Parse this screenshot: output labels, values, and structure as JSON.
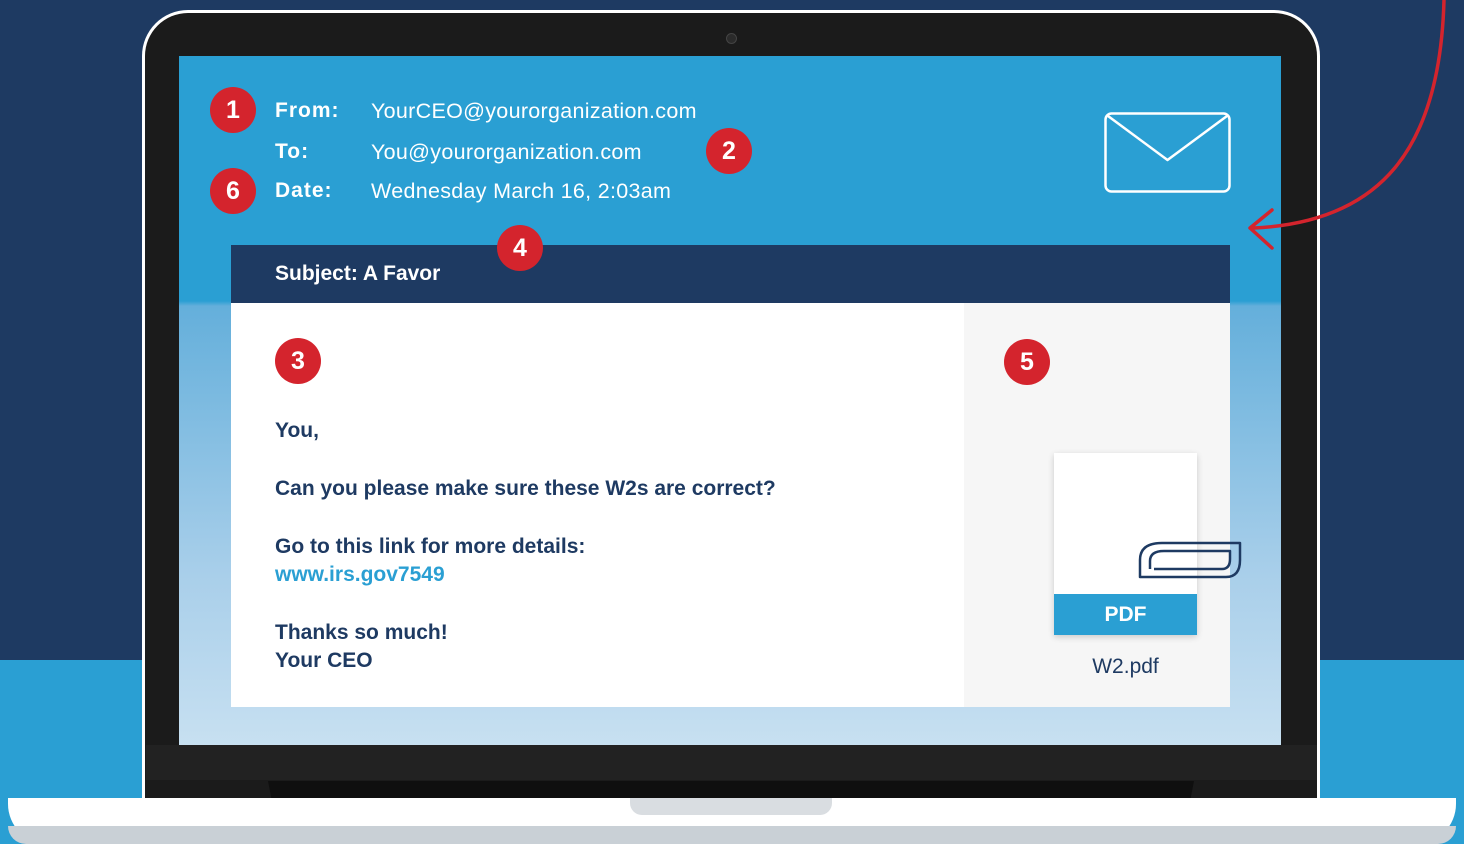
{
  "email": {
    "from_label": "From:",
    "from_value": "YourCEO@yourorganization.com",
    "to_label": "To:",
    "to_value": "You@yourorganization.com",
    "date_label": "Date:",
    "date_value": "Wednesday March 16, 2:03am",
    "subject": "Subject: A Favor",
    "body": {
      "greeting": "You,",
      "line1": "Can you please make sure these W2s are correct?",
      "line2": "Go to this link for more details:",
      "link": "www.irs.gov7549",
      "signoff1": "Thanks so much!",
      "signoff2": "Your CEO"
    },
    "attachment": {
      "type_label": "PDF",
      "filename": "W2.pdf"
    }
  },
  "badges": [
    "1",
    "2",
    "3",
    "4",
    "5",
    "6"
  ],
  "icons": {
    "envelope": "envelope-icon",
    "paperclip": "paperclip-icon",
    "arrow": "curved-arrow-icon"
  },
  "colors": {
    "navy": "#1e3a62",
    "sky": "#2a9fd3",
    "badge_red": "#d4242d",
    "white": "#ffffff"
  }
}
